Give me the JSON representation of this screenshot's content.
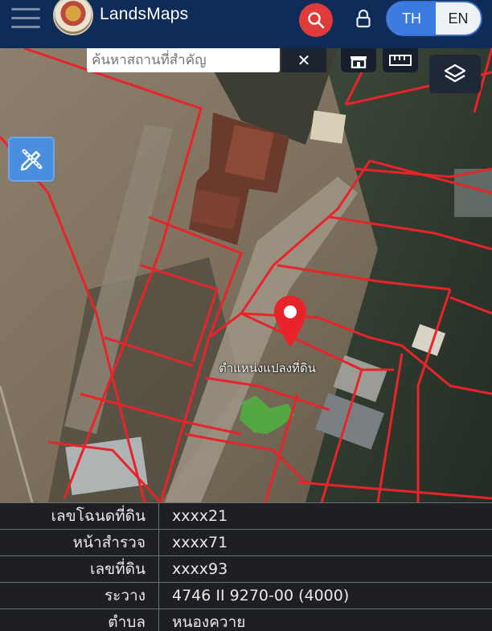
{
  "header": {
    "app_title": "LandsMaps",
    "logo_icon": "thai-emblem-icon",
    "search_icon": "search-icon",
    "lock_icon": "lock-icon",
    "menu_icon": "hamburger-menu-icon",
    "languages": {
      "th": "TH",
      "en": "EN",
      "selected": "TH"
    },
    "accent_color": "#3b7be0",
    "search_button_color": "#e03b3b",
    "bar_color": "#0f2b57"
  },
  "map": {
    "search_placeholder": "ค้นหาสถานที่สำคัญ",
    "clear_icon": "close-icon",
    "tools": [
      "home-icon",
      "ruler-icon"
    ],
    "layers_icon": "layers-icon",
    "draw_icon": "pencil-ruler-icon",
    "pin_icon": "location-pin-icon",
    "pin_label": "ตำแหน่งแปลงที่ดิน",
    "parcel_line_color": "#e8242a"
  },
  "parcel_info": {
    "rows": [
      {
        "key": "เลขโฉนดที่ดิน",
        "value": "xxxx21"
      },
      {
        "key": "หน้าสำรวจ",
        "value": "xxxx71"
      },
      {
        "key": "เลขที่ดิน",
        "value": "xxxx93"
      },
      {
        "key": "ระวาง",
        "value": "4746 II 9270-00 (4000)"
      },
      {
        "key": "ตำบล",
        "value": "หนองควาย"
      }
    ]
  }
}
